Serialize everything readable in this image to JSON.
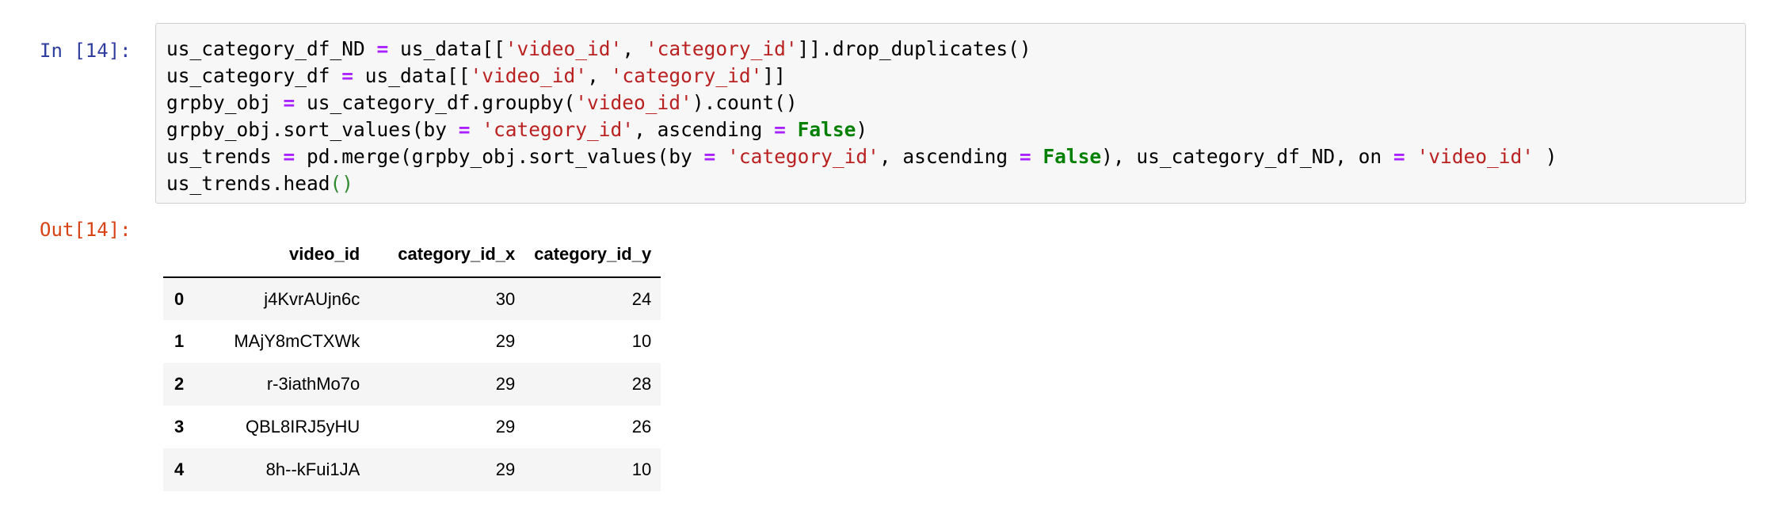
{
  "input_prompt": "In [14]:",
  "output_prompt": "Out[14]:",
  "colors": {
    "in_prompt": "#303F9F",
    "out_prompt": "#D84315",
    "operator": "#AA22FF",
    "string": "#BA2121",
    "keyword": "#008000",
    "code_background": "#f7f7f7"
  },
  "code_lines": [
    [
      {
        "t": "us_category_df_ND "
      },
      {
        "t": "=",
        "k": "op"
      },
      {
        "t": " us_data[["
      },
      {
        "t": "'video_id'",
        "k": "str"
      },
      {
        "t": ", "
      },
      {
        "t": "'category_id'",
        "k": "str"
      },
      {
        "t": "]].drop_duplicates()"
      }
    ],
    [
      {
        "t": "us_category_df "
      },
      {
        "t": "=",
        "k": "op"
      },
      {
        "t": " us_data[["
      },
      {
        "t": "'video_id'",
        "k": "str"
      },
      {
        "t": ", "
      },
      {
        "t": "'category_id'",
        "k": "str"
      },
      {
        "t": "]]"
      }
    ],
    [
      {
        "t": "grpby_obj "
      },
      {
        "t": "=",
        "k": "op"
      },
      {
        "t": " us_category_df.groupby("
      },
      {
        "t": "'video_id'",
        "k": "str"
      },
      {
        "t": ").count()"
      }
    ],
    [
      {
        "t": "grpby_obj.sort_values(by "
      },
      {
        "t": "=",
        "k": "op"
      },
      {
        "t": " "
      },
      {
        "t": "'category_id'",
        "k": "str"
      },
      {
        "t": ", ascending "
      },
      {
        "t": "=",
        "k": "op"
      },
      {
        "t": " "
      },
      {
        "t": "False",
        "k": "kw"
      },
      {
        "t": ")"
      }
    ],
    [
      {
        "t": "us_trends "
      },
      {
        "t": "=",
        "k": "op"
      },
      {
        "t": " pd.merge(grpby_obj.sort_values(by "
      },
      {
        "t": "=",
        "k": "op"
      },
      {
        "t": " "
      },
      {
        "t": "'category_id'",
        "k": "str"
      },
      {
        "t": ", ascending "
      },
      {
        "t": "=",
        "k": "op"
      },
      {
        "t": " "
      },
      {
        "t": "False",
        "k": "kw"
      },
      {
        "t": "), us_category_df_ND, on "
      },
      {
        "t": "=",
        "k": "op"
      },
      {
        "t": " "
      },
      {
        "t": "'video_id'",
        "k": "str"
      },
      {
        "t": " )"
      }
    ],
    [
      {
        "t": "us_trends.head"
      },
      {
        "t": "()",
        "k": "paren"
      }
    ]
  ],
  "table": {
    "index_header": "",
    "columns": [
      "video_id",
      "category_id_x",
      "category_id_y"
    ],
    "rows": [
      {
        "index": "0",
        "cells": [
          "j4KvrAUjn6c",
          "30",
          "24"
        ]
      },
      {
        "index": "1",
        "cells": [
          "MAjY8mCTXWk",
          "29",
          "10"
        ]
      },
      {
        "index": "2",
        "cells": [
          "r-3iathMo7o",
          "29",
          "28"
        ]
      },
      {
        "index": "3",
        "cells": [
          "QBL8IRJ5yHU",
          "29",
          "26"
        ]
      },
      {
        "index": "4",
        "cells": [
          "8h--kFui1JA",
          "29",
          "10"
        ]
      }
    ]
  }
}
